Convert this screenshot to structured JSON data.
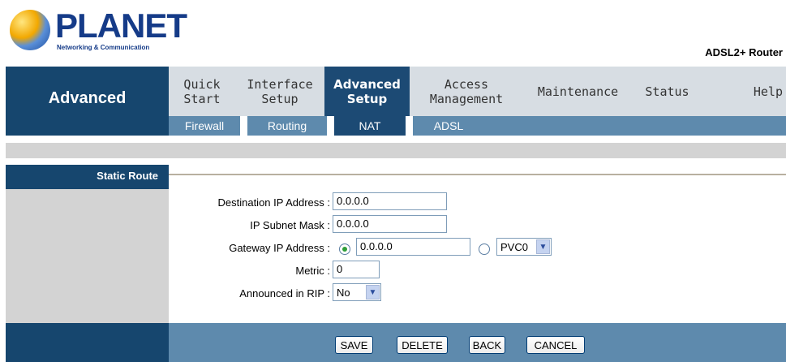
{
  "branding": {
    "logo_text": "PLANET",
    "logo_subtitle": "Networking & Communication",
    "product_name": "ADSL2+ Router"
  },
  "section_title": "Advanced",
  "menu": [
    {
      "label": "Quick\nStart"
    },
    {
      "label": "Interface\nSetup"
    },
    {
      "label": "Advanced\nSetup"
    },
    {
      "label": "Access\nManagement"
    },
    {
      "label": "Maintenance"
    },
    {
      "label": "Status"
    },
    {
      "label": "Help"
    }
  ],
  "submenu": [
    {
      "label": "Firewall"
    },
    {
      "label": "Routing"
    },
    {
      "label": "NAT"
    },
    {
      "label": "ADSL"
    }
  ],
  "page": {
    "section_label": "Static Route"
  },
  "form": {
    "destination": {
      "label": "Destination IP Address :",
      "value": "0.0.0.0"
    },
    "subnet": {
      "label": "IP Subnet Mask :",
      "value": "0.0.0.0"
    },
    "gateway": {
      "label": "Gateway IP Address :",
      "value": "0.0.0.0",
      "pvc_value": "PVC0"
    },
    "metric": {
      "label": "Metric :",
      "value": "0"
    },
    "rip": {
      "label": "Announced in RIP :",
      "value": "No"
    }
  },
  "buttons": {
    "save": "SAVE",
    "delete": "DELETE",
    "back": "BACK",
    "cancel": "CANCEL"
  }
}
